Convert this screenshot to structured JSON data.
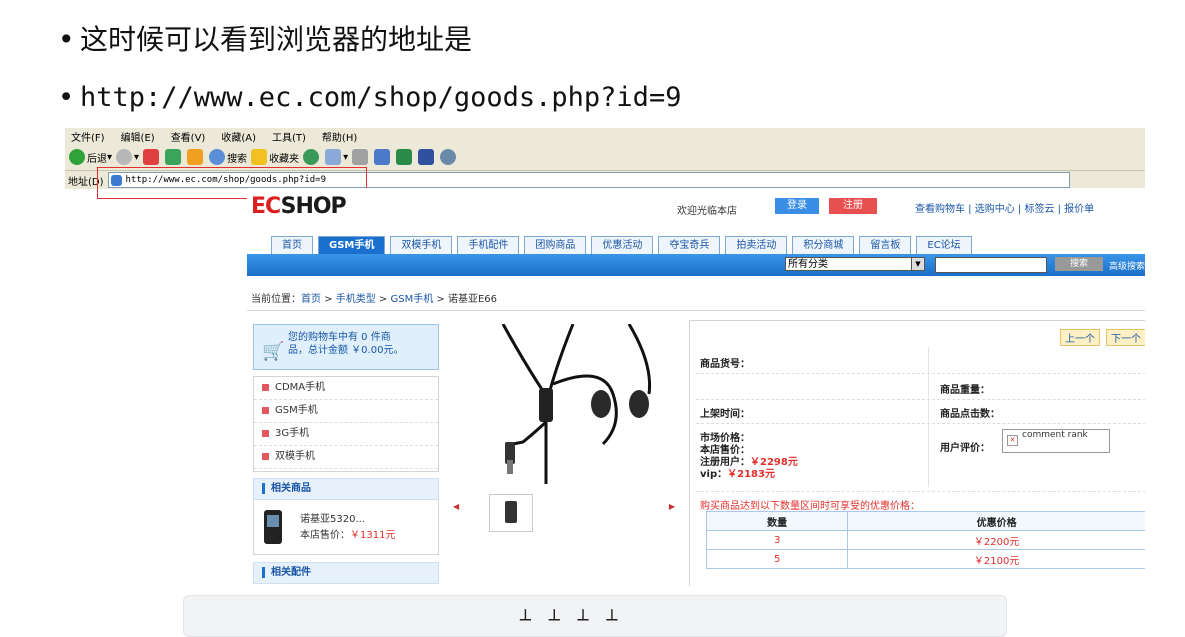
{
  "bullets": {
    "line1": "这时候可以看到浏览器的地址是",
    "line2": "http://www.ec.com/shop/goods.php?id=9"
  },
  "browser": {
    "menu": [
      "文件(F)",
      "编辑(E)",
      "查看(V)",
      "收藏(A)",
      "工具(T)",
      "帮助(H)"
    ],
    "toolbar": {
      "back": "后退",
      "search": "搜索",
      "favorites": "收藏夹"
    },
    "address_label": "地址(D)",
    "address_value": "http://www.ec.com/shop/goods.php?id=9"
  },
  "site": {
    "logo_a": "EC",
    "logo_b": "SHOP",
    "welcome": "欢迎光临本店",
    "login": "登录",
    "register": "注册",
    "toplinks": "查看购物车 | 选购中心 | 标签云 | 报价单",
    "nav": [
      "首页",
      "GSM手机",
      "双模手机",
      "手机配件",
      "团购商品",
      "优惠活动",
      "夺宝奇兵",
      "拍卖活动",
      "积分商城",
      "留言板",
      "EC论坛"
    ],
    "category_select": "所有分类",
    "search_button": "搜索",
    "advanced_search": "高级搜索",
    "breadcrumb": {
      "prefix": "当前位置：",
      "home": "首页",
      "type": "手机类型",
      "cat": "GSM手机",
      "product": "诺基亚E66",
      "sep": " > "
    },
    "cart": {
      "line1": "您的购物车中有 0 件商",
      "line2": "品，总计金额 ￥0.00元。"
    },
    "categories": [
      "CDMA手机",
      "GSM手机",
      "3G手机",
      "双模手机"
    ],
    "related_title": "相关商品",
    "related_item": {
      "name": "诺基亚5320...",
      "price_label": "本店售价：",
      "price": "￥1311元"
    },
    "accessories_title": "相关配件",
    "prev": "上一个",
    "next": "下一个",
    "labels": {
      "sn": "商品货号：",
      "weight": "商品重量：",
      "added": "上架时间：",
      "clicks": "商品点击数：",
      "market_price": "市场价格：",
      "shop_price": "本店售价：",
      "member_price": "注册用户：",
      "member_value": "￥2298元",
      "vip_price": "vip：",
      "vip_value": "￥2183元",
      "rating": "用户评价：",
      "rank_alt": "comment rank"
    },
    "promo_text": "购买商品达到以下数量区间时可享受的优惠价格：",
    "promo_table": {
      "headers": [
        "数量",
        "优惠价格"
      ],
      "rows": [
        [
          "3",
          "￥2200元"
        ],
        [
          "5",
          "￥2100元"
        ]
      ]
    }
  }
}
